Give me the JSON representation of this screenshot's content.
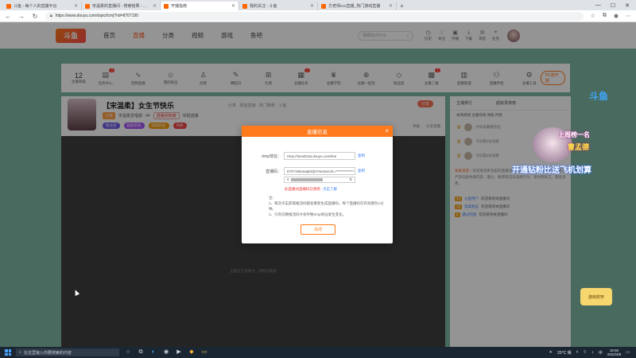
{
  "browser": {
    "tabs": [
      {
        "title": "斗鱼 - 每个人的直播平台",
        "active": false
      },
      {
        "title": "宋温柔的直播间 - 搜索结果 - 斗鱼",
        "active": false
      },
      {
        "title": "开播指南",
        "active": true
      },
      {
        "title": "我的关注 - 斗鱼",
        "active": false
      },
      {
        "title": "方老师ccc直播_热门游戏直播",
        "active": false
      }
    ],
    "new_tab": "+",
    "url": "https://www.douyu.com/topic/lcmj?rid=8707195",
    "window_controls": [
      "—",
      "☐",
      "✕"
    ]
  },
  "site": {
    "logo": "斗鱼",
    "nav": [
      "首页",
      "直播",
      "分类",
      "视频",
      "游戏",
      "鱼吧"
    ],
    "nav_active": 1,
    "search_placeholder": "猜猜玩点什么",
    "header_icons": [
      "历史",
      "关注",
      "开播",
      "下载",
      "消息",
      "任务"
    ],
    "avatar_color": "#7a4d5a"
  },
  "function_bar": {
    "level_num": "12",
    "level_label": "主播等级",
    "items": [
      {
        "label": "任务中心",
        "badge": "3"
      },
      {
        "label": "音频直播",
        "badge": ""
      },
      {
        "label": "我的粉丝",
        "badge": ""
      },
      {
        "label": "房管",
        "badge": ""
      },
      {
        "label": "赛程日",
        "badge": ""
      },
      {
        "label": "礼物",
        "badge": ""
      },
      {
        "label": "主播任务",
        "badge": "1"
      },
      {
        "label": "主播学院",
        "badge": ""
      },
      {
        "label": "主播一起玩",
        "badge": ""
      },
      {
        "label": "粉丝团",
        "badge": ""
      },
      {
        "label": "主播二维",
        "badge": "1"
      },
      {
        "label": "直播管理",
        "badge": ""
      },
      {
        "label": "直播伴侣",
        "badge": ""
      },
      {
        "label": "主播工具",
        "badge": ""
      }
    ],
    "pc_button": "PC端开播"
  },
  "room": {
    "title": "【宋温柔】女生节快乐",
    "category": "分类 · 颜值直播 · 热门推荐 · 斗鱼",
    "tag_main": "分类",
    "streamer_name": "宋温柔爱唱歌",
    "level": "44",
    "tag_red": "直播间热度",
    "report": "举报直播",
    "pills": [
      "粉丝团",
      "超级贵族",
      "超级粉丝",
      "热榜"
    ],
    "share": "分享",
    "right_links": [
      "举报",
      "分享直播"
    ],
    "video_tip": "主播正在准备中，请稍后播放"
  },
  "chat": {
    "tabs": [
      "主播排行",
      "超级贵族榜"
    ],
    "subtitle": "本周周榜 主播日榜 周榜 月榜",
    "ranks": [
      "今日贡献榜首位",
      "今日第2位贡献",
      "今日第3位贡献"
    ],
    "notice_prefix": "系统消息：",
    "notice": "欢迎来到宋温柔的直播间，斗鱼严禁未成年人直播及打赏，严禁低俗色情内容、暴力、赌博等违法违规行为，请文明发言，理性消费。",
    "messages": [
      {
        "lv": "12",
        "name": "斗鱼用户",
        "text": "欢迎来到本直播间"
      },
      {
        "lv": "10",
        "name": "温柔粉丝",
        "text": "欢迎来到本直播间"
      },
      {
        "lv": "8",
        "name": "路过的鱼",
        "text": "欢迎来到本直播间"
      }
    ]
  },
  "overlay": {
    "line1": "上周榜一名",
    "line2": "曹孟德",
    "line3": "开通钻粉比送飞机划算",
    "douyu_badge": "斗鱼",
    "game_badge": "游戏奖杯"
  },
  "modal": {
    "title": "直播信息",
    "close_icon": "×",
    "rtmp_label": "rtmp地址：",
    "rtmp_value": "rtmp://sendtc3a.douyu.com/live",
    "code_label": "直播码：",
    "code_value": "8707195rwapt0zjN?wsSecret=*************",
    "copy_label": "复制",
    "switch_glyph": "⇅",
    "info": "此直播间直播码已更新",
    "info_link": "点击了解",
    "notes_title": "注：",
    "notes": [
      "1、每次点击获取推流码都会重新生成直播码，每个直播码仅有效期为1分钟。",
      "2、只有切换推流码才会导致rtmp地址发生变化。"
    ],
    "close_button": "关闭"
  },
  "taskbar": {
    "search_placeholder": "在这里输入你要搜索的内容",
    "weather": "20°C 晴",
    "time": "16:50",
    "date": "2022/3/8"
  }
}
